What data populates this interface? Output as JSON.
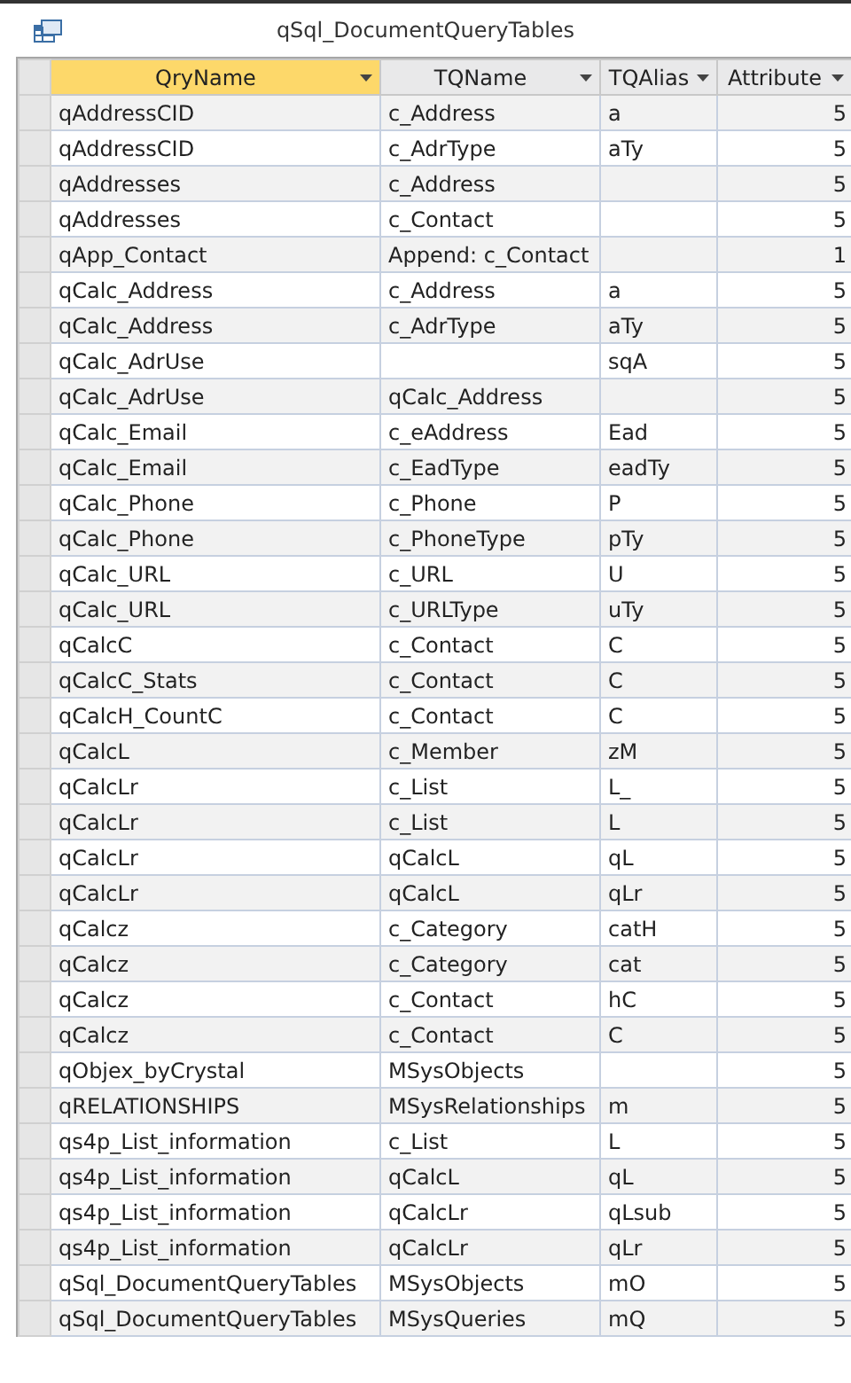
{
  "window": {
    "title": "qSql_DocumentQueryTables"
  },
  "table": {
    "columns": [
      {
        "label": "QryName",
        "selected": true
      },
      {
        "label": "TQName",
        "selected": false
      },
      {
        "label": "TQAlias",
        "selected": false
      },
      {
        "label": "Attribute",
        "selected": false
      }
    ],
    "rows": [
      {
        "qry_name": "qAddressCID",
        "tq_name": "c_Address",
        "tq_alias": "a",
        "attribute": "5"
      },
      {
        "qry_name": "qAddressCID",
        "tq_name": "c_AdrType",
        "tq_alias": "aTy",
        "attribute": "5"
      },
      {
        "qry_name": "qAddresses",
        "tq_name": "c_Address",
        "attribute": "5"
      },
      {
        "qry_name": "qAddresses",
        "tq_name": "c_Contact",
        "attribute": "5"
      },
      {
        "qry_name": "qApp_Contact",
        "tq_name": "Append: c_Contact",
        "attribute": "1"
      },
      {
        "qry_name": "qCalc_Address",
        "tq_name": "c_Address",
        "tq_alias": "a",
        "attribute": "5"
      },
      {
        "qry_name": "qCalc_Address",
        "tq_name": "c_AdrType",
        "tq_alias": "aTy",
        "attribute": "5"
      },
      {
        "qry_name": "qCalc_AdrUse",
        "tq_alias": "sqA",
        "attribute": "5"
      },
      {
        "qry_name": "qCalc_AdrUse",
        "tq_name": "qCalc_Address",
        "attribute": "5"
      },
      {
        "qry_name": "qCalc_Email",
        "tq_name": "c_eAddress",
        "tq_alias": "Ead",
        "attribute": "5"
      },
      {
        "qry_name": "qCalc_Email",
        "tq_name": "c_EadType",
        "tq_alias": "eadTy",
        "attribute": "5"
      },
      {
        "qry_name": "qCalc_Phone",
        "tq_name": "c_Phone",
        "tq_alias": "P",
        "attribute": "5"
      },
      {
        "qry_name": "qCalc_Phone",
        "tq_name": "c_PhoneType",
        "tq_alias": "pTy",
        "attribute": "5"
      },
      {
        "qry_name": "qCalc_URL",
        "tq_name": "c_URL",
        "tq_alias": "U",
        "attribute": "5"
      },
      {
        "qry_name": "qCalc_URL",
        "tq_name": "c_URLType",
        "tq_alias": "uTy",
        "attribute": "5"
      },
      {
        "qry_name": "qCalcC",
        "tq_name": "c_Contact",
        "tq_alias": "C",
        "attribute": "5"
      },
      {
        "qry_name": "qCalcC_Stats",
        "tq_name": "c_Contact",
        "tq_alias": "C",
        "attribute": "5"
      },
      {
        "qry_name": "qCalcH_CountC",
        "tq_name": "c_Contact",
        "tq_alias": "C",
        "attribute": "5"
      },
      {
        "qry_name": "qCalcL",
        "tq_name": "c_Member",
        "tq_alias": "zM",
        "attribute": "5"
      },
      {
        "qry_name": "qCalcLr",
        "tq_name": "c_List",
        "tq_alias": "L_",
        "attribute": "5"
      },
      {
        "qry_name": "qCalcLr",
        "tq_name": "c_List",
        "tq_alias": "L",
        "attribute": "5"
      },
      {
        "qry_name": "qCalcLr",
        "tq_name": "qCalcL",
        "tq_alias": "qL",
        "attribute": "5"
      },
      {
        "qry_name": "qCalcLr",
        "tq_name": "qCalcL",
        "tq_alias": "qLr",
        "attribute": "5"
      },
      {
        "qry_name": "qCalcz",
        "tq_name": "c_Category",
        "tq_alias": "catH",
        "attribute": "5"
      },
      {
        "qry_name": "qCalcz",
        "tq_name": "c_Category",
        "tq_alias": "cat",
        "attribute": "5"
      },
      {
        "qry_name": "qCalcz",
        "tq_name": "c_Contact",
        "tq_alias": "hC",
        "attribute": "5"
      },
      {
        "qry_name": "qCalcz",
        "tq_name": "c_Contact",
        "tq_alias": "C",
        "attribute": "5"
      },
      {
        "qry_name": "qObjex_byCrystal",
        "tq_name": "MSysObjects",
        "attribute": "5"
      },
      {
        "qry_name": "qRELATIONSHIPS",
        "tq_name": "MSysRelationships",
        "tq_alias": "m",
        "attribute": "5"
      },
      {
        "qry_name": "qs4p_List_information",
        "tq_name": "c_List",
        "tq_alias": "L",
        "attribute": "5"
      },
      {
        "qry_name": "qs4p_List_information",
        "tq_name": "qCalcL",
        "tq_alias": "qL",
        "attribute": "5"
      },
      {
        "qry_name": "qs4p_List_information",
        "tq_name": "qCalcLr",
        "tq_alias": "qLsub",
        "attribute": "5"
      },
      {
        "qry_name": "qs4p_List_information",
        "tq_name": "qCalcLr",
        "tq_alias": "qLr",
        "attribute": "5"
      },
      {
        "qry_name": "qSql_DocumentQueryTables",
        "tq_name": "MSysObjects",
        "tq_alias": "mO",
        "attribute": "5"
      },
      {
        "qry_name": "qSql_DocumentQueryTables",
        "tq_name": "MSysQueries",
        "tq_alias": "mQ",
        "attribute": "5"
      }
    ]
  }
}
